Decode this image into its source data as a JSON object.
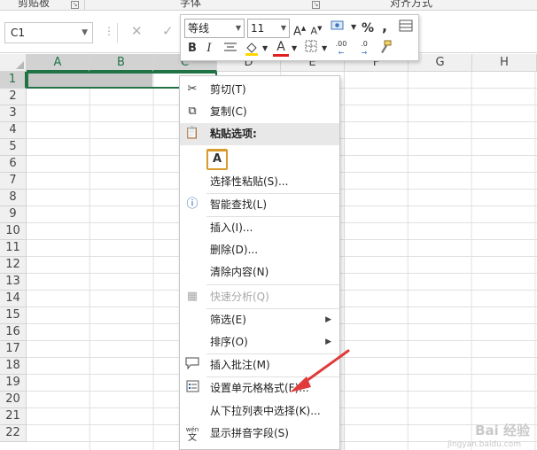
{
  "ribbon": {
    "groups": [
      "剪贴板",
      "字体",
      "对齐方式"
    ]
  },
  "formula_bar": {
    "name_box_value": "C1",
    "dots": "⋮",
    "cancel_glyph": "✕",
    "enter_glyph": "✓"
  },
  "columns": [
    "A",
    "B",
    "C",
    "D",
    "E",
    "F",
    "G",
    "H"
  ],
  "rows": [
    "1",
    "2",
    "3",
    "4",
    "5",
    "6",
    "7",
    "8",
    "9",
    "10",
    "11",
    "12",
    "13",
    "14",
    "15",
    "16",
    "17",
    "18",
    "19",
    "20",
    "21",
    "22"
  ],
  "mini_toolbar": {
    "font_name": "等线",
    "font_size": "11",
    "grow_font": "A",
    "shrink_font": "A",
    "percent": "%",
    "comma": ",",
    "bold": "B",
    "italic": "I",
    "font_color_letter": "A",
    "increase_decimal": ".00",
    "decrease_decimal": ".0",
    "accent_red": "#e02020",
    "accent_yellow": "#ffd800"
  },
  "context_menu": {
    "items": [
      {
        "label": "剪切(T)",
        "icon": "scissors-icon"
      },
      {
        "label": "复制(C)",
        "icon": "copy-icon"
      },
      {
        "label": "粘贴选项:",
        "icon": "paste-icon"
      },
      {
        "label": "",
        "icon": "paste-keep-formatting-icon"
      },
      {
        "label": "选择性粘贴(S)...",
        "icon": ""
      },
      {
        "label": "智能查找(L)",
        "icon": "smart-lookup-icon"
      },
      {
        "label": "插入(I)...",
        "icon": ""
      },
      {
        "label": "删除(D)...",
        "icon": ""
      },
      {
        "label": "清除内容(N)",
        "icon": ""
      },
      {
        "label": "快速分析(Q)",
        "icon": "quick-analysis-icon"
      },
      {
        "label": "筛选(E)",
        "icon": ""
      },
      {
        "label": "排序(O)",
        "icon": ""
      },
      {
        "label": "插入批注(M)",
        "icon": "comment-icon"
      },
      {
        "label": "设置单元格格式(F)...",
        "icon": "format-cells-icon"
      },
      {
        "label": "从下拉列表中选择(K)...",
        "icon": ""
      },
      {
        "label": "显示拼音字段(S)",
        "icon": "phonetic-icon"
      }
    ],
    "wen_glyph": "文",
    "wen_top": "wén",
    "paste_glyph": "A"
  },
  "watermark": {
    "text": "Bai 经验",
    "sub": "jingyan.baidu.com"
  }
}
